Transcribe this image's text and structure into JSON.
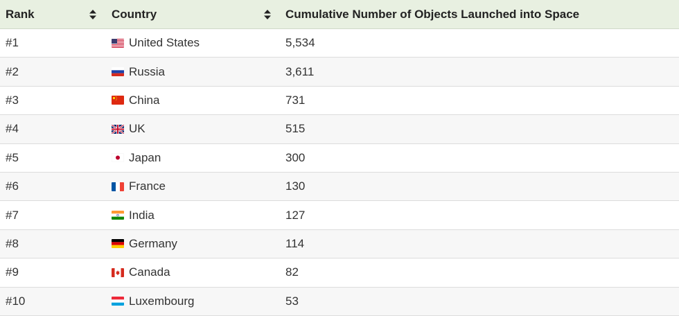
{
  "table": {
    "headers": {
      "rank": "Rank",
      "country": "Country",
      "count": "Cumulative Number of Objects Launched into Space"
    },
    "rows": [
      {
        "rank": "#1",
        "country": "United States",
        "count": "5,534",
        "flag": "us-flag-icon"
      },
      {
        "rank": "#2",
        "country": "Russia",
        "count": "3,611",
        "flag": "russia-flag-icon"
      },
      {
        "rank": "#3",
        "country": "China",
        "count": "731",
        "flag": "china-flag-icon"
      },
      {
        "rank": "#4",
        "country": "UK",
        "count": "515",
        "flag": "uk-flag-icon"
      },
      {
        "rank": "#5",
        "country": "Japan",
        "count": "300",
        "flag": "japan-flag-icon"
      },
      {
        "rank": "#6",
        "country": "France",
        "count": "130",
        "flag": "france-flag-icon"
      },
      {
        "rank": "#7",
        "country": "India",
        "count": "127",
        "flag": "india-flag-icon"
      },
      {
        "rank": "#8",
        "country": "Germany",
        "count": "114",
        "flag": "germany-flag-icon"
      },
      {
        "rank": "#9",
        "country": "Canada",
        "count": "82",
        "flag": "canada-flag-icon"
      },
      {
        "rank": "#10",
        "country": "Luxembourg",
        "count": "53",
        "flag": "luxembourg-flag-icon"
      }
    ]
  },
  "colors": {
    "header_bg": "#e8f0e1",
    "row_alt_bg": "#f7f7f7",
    "text": "#333333"
  }
}
